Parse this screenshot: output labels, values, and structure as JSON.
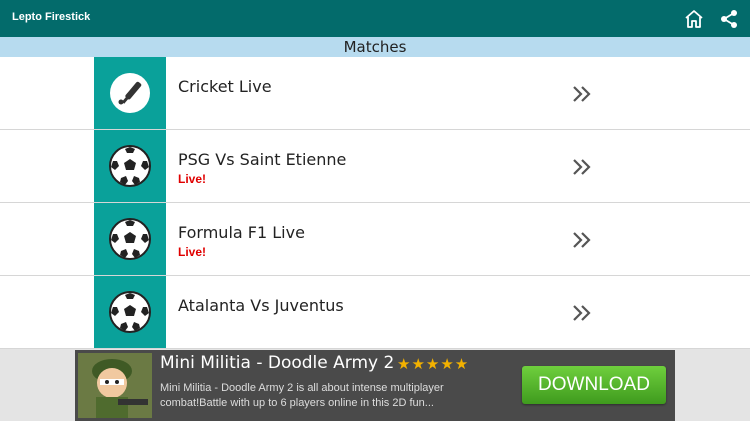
{
  "app": {
    "title": "Lepto Firestick"
  },
  "header": {
    "section_title": "Matches"
  },
  "matches": [
    {
      "title": "Cricket Live",
      "status": "",
      "icon": "cricket-bat-icon"
    },
    {
      "title": "PSG Vs Saint Etienne",
      "status": "Live!",
      "icon": "soccer-ball-icon"
    },
    {
      "title": "Formula F1 Live",
      "status": "Live!",
      "icon": "soccer-ball-icon"
    },
    {
      "title": "Atalanta Vs Juventus",
      "status": "",
      "icon": "soccer-ball-icon"
    }
  ],
  "ad": {
    "title": "Mini Militia - Doodle Army 2",
    "stars": "★★★★★",
    "rating": 4.5,
    "description": "Mini Militia - Doodle Army 2 is all about intense multiplayer combat!Battle with up to 6 players online in this 2D fun...",
    "cta": "DOWNLOAD"
  },
  "colors": {
    "appbar": "#036b6b",
    "section_bar": "#b7dbef",
    "thumb_bg": "#0aa19a",
    "live_red": "#e00000",
    "download_green": "#4fb626"
  }
}
